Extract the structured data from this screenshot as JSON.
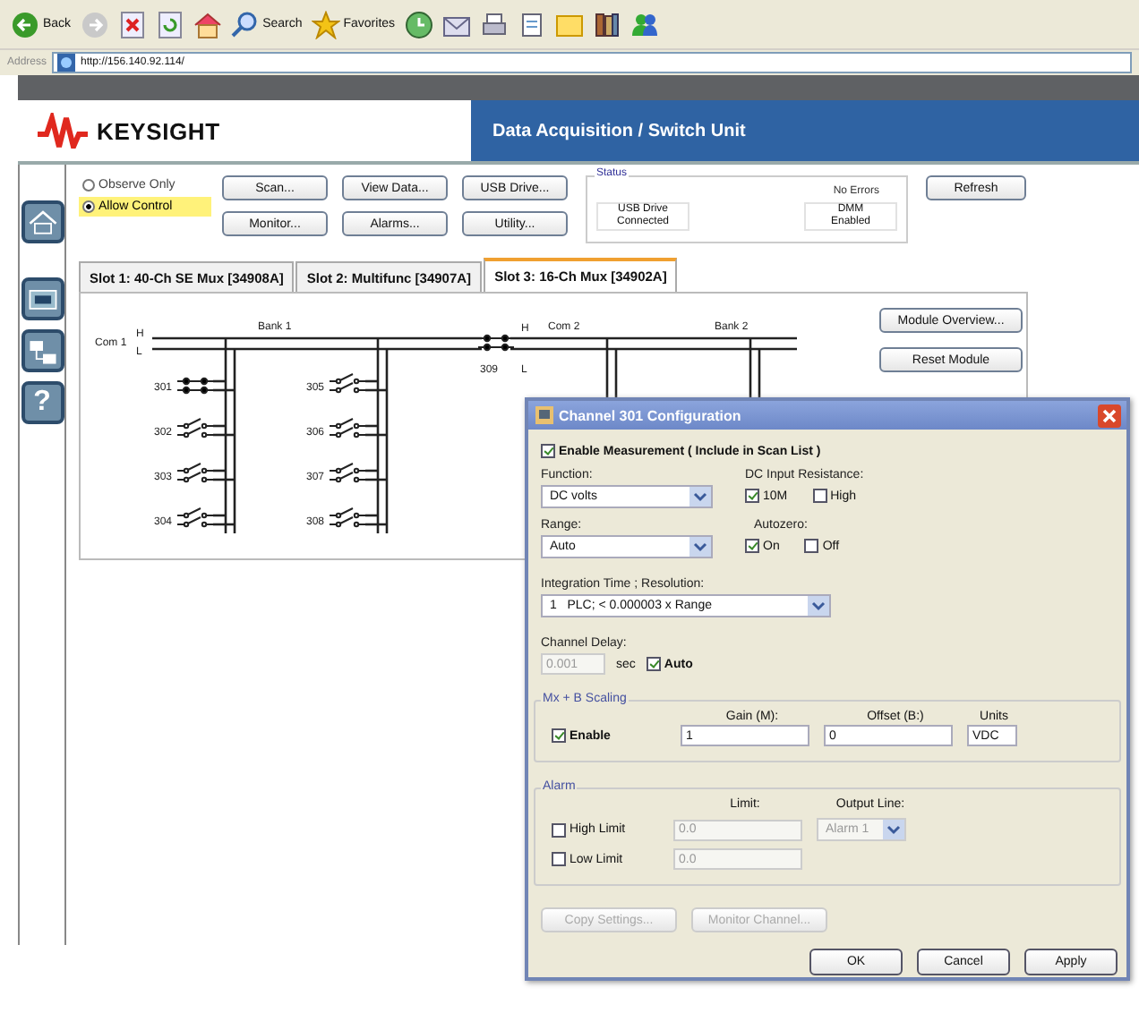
{
  "browser": {
    "toolbar": [
      {
        "kind": "back",
        "label": "Back"
      },
      {
        "kind": "forward"
      },
      {
        "kind": "stop"
      },
      {
        "kind": "refresh"
      },
      {
        "kind": "home"
      },
      {
        "kind": "search",
        "label": "Search"
      },
      {
        "kind": "favorites",
        "label": "Favorites"
      },
      {
        "kind": "history"
      },
      {
        "kind": "mail"
      },
      {
        "kind": "print"
      },
      {
        "kind": "edit"
      },
      {
        "kind": "folder"
      },
      {
        "kind": "research"
      },
      {
        "kind": "messenger"
      }
    ],
    "address_label": "Address",
    "url": "http://156.140.92.114/"
  },
  "header": {
    "logo": "KEYSIGHT",
    "title": "Data Acquisition / Switch Unit"
  },
  "sidebar": [
    {
      "kind": "home"
    },
    {
      "kind": "module"
    },
    {
      "kind": "network"
    },
    {
      "kind": "help",
      "label": "?"
    }
  ],
  "mode": [
    {
      "label": "Observe Only",
      "selected": false
    },
    {
      "label": "Allow Control",
      "selected": true
    }
  ],
  "actions": [
    {
      "label": "Scan..."
    },
    {
      "label": "View Data..."
    },
    {
      "label": "USB Drive..."
    },
    {
      "label": "Monitor..."
    },
    {
      "label": "Alarms..."
    },
    {
      "label": "Utility..."
    }
  ],
  "status": {
    "title": "Status",
    "message": "No Errors",
    "items": [
      {
        "label": "USB Drive",
        "value": "Connected"
      },
      {
        "label": "DMM",
        "value": "Enabled"
      }
    ]
  },
  "refresh": "Refresh",
  "tabs": [
    {
      "label": "Slot 1:  40-Ch SE Mux [34908A]",
      "selected": false
    },
    {
      "label": "Slot 2:  Multifunc [34907A]",
      "selected": false
    },
    {
      "label": "Slot 3:  16-Ch Mux [34902A]",
      "selected": true
    }
  ],
  "module_buttons": [
    "Module Overview...",
    "Reset Module"
  ],
  "schematic": {
    "com1": "Com 1",
    "com1_terminals": [
      "H",
      "L"
    ],
    "bank1": "Bank 1",
    "com2": "Com 2",
    "com2_terminals": [
      "H",
      "L"
    ],
    "bank2": "Bank 2",
    "bridge": {
      "label": "309",
      "closed": true
    },
    "channels": [
      {
        "label": "301",
        "closed": true
      },
      {
        "label": "302",
        "closed": false
      },
      {
        "label": "303",
        "closed": false
      },
      {
        "label": "304",
        "closed": false
      },
      {
        "label": "305",
        "closed": false
      },
      {
        "label": "306",
        "closed": false
      },
      {
        "label": "307",
        "closed": false
      },
      {
        "label": "308",
        "closed": false
      }
    ]
  },
  "dialog": {
    "title": "Channel 301 Configuration",
    "enable": {
      "label": "Enable Measurement ( Include in Scan List )",
      "checked": true
    },
    "function": {
      "label": "Function:",
      "value": "DC volts"
    },
    "resistance": {
      "label": "DC Input Resistance:",
      "options": [
        {
          "label": "10M",
          "checked": true
        },
        {
          "label": "High",
          "checked": false
        }
      ]
    },
    "range": {
      "label": "Range:",
      "value": "Auto"
    },
    "autozero": {
      "label": "Autozero:",
      "options": [
        {
          "label": "On",
          "checked": true
        },
        {
          "label": "Off",
          "checked": false
        }
      ]
    },
    "integration": {
      "label": "Integration Time ; Resolution:",
      "value": "1   PLC; < 0.000003 x Range"
    },
    "delay": {
      "label": "Channel Delay:",
      "value": "0.001",
      "unit": "sec",
      "auto": {
        "label": "Auto",
        "checked": true
      }
    },
    "scaling": {
      "title": "Mx + B Scaling",
      "enable": {
        "label": "Enable",
        "checked": true
      },
      "gain": {
        "label": "Gain (M):",
        "value": "1"
      },
      "offset": {
        "label": "Offset (B:)",
        "value": "0"
      },
      "units": {
        "label": "Units",
        "value": "VDC"
      }
    },
    "alarm": {
      "title": "Alarm",
      "limit_label": "Limit:",
      "output_label": "Output Line:",
      "rows": [
        {
          "label": "High Limit",
          "checked": false,
          "value": "0.0",
          "output": "Alarm 1"
        },
        {
          "label": "Low Limit",
          "checked": false,
          "value": "0.0"
        }
      ]
    },
    "aux_buttons": [
      {
        "label": "Copy Settings...",
        "disabled": true
      },
      {
        "label": "Monitor Channel...",
        "disabled": true
      }
    ],
    "buttons": [
      "OK",
      "Cancel",
      "Apply"
    ]
  }
}
